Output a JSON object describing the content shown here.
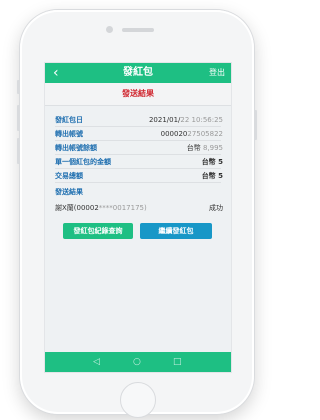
{
  "header": {
    "back_icon": "‹",
    "title": "發紅包",
    "logout": "登出"
  },
  "result": {
    "section_title": "發送結果",
    "rows": [
      {
        "label": "發紅包日",
        "value_prefix": "2021/01/",
        "value_blur": "22 10:56:25"
      },
      {
        "label": "轉出帳號",
        "value_prefix": "000020",
        "value_blur": "27505822"
      },
      {
        "label": "轉出帳號餘額",
        "value_prefix": "台幣 ",
        "value_blur": "8,995"
      },
      {
        "label": "單一個紅包的金額",
        "value_prefix": "台幣 5",
        "value_blur": ""
      },
      {
        "label": "交易總額",
        "value_prefix": "台幣 5",
        "value_blur": ""
      }
    ],
    "recipients_label": "發送結果",
    "recipient": {
      "name_prefix": "謝X蘭(00002",
      "name_blur": "****0017175)",
      "status": "成功"
    }
  },
  "buttons": {
    "history": "發紅包紀錄查詢",
    "continue": "繼續發紅包"
  },
  "navbar": {
    "back_icon": "◁",
    "home_icon": "○",
    "recent_icon": "□"
  }
}
